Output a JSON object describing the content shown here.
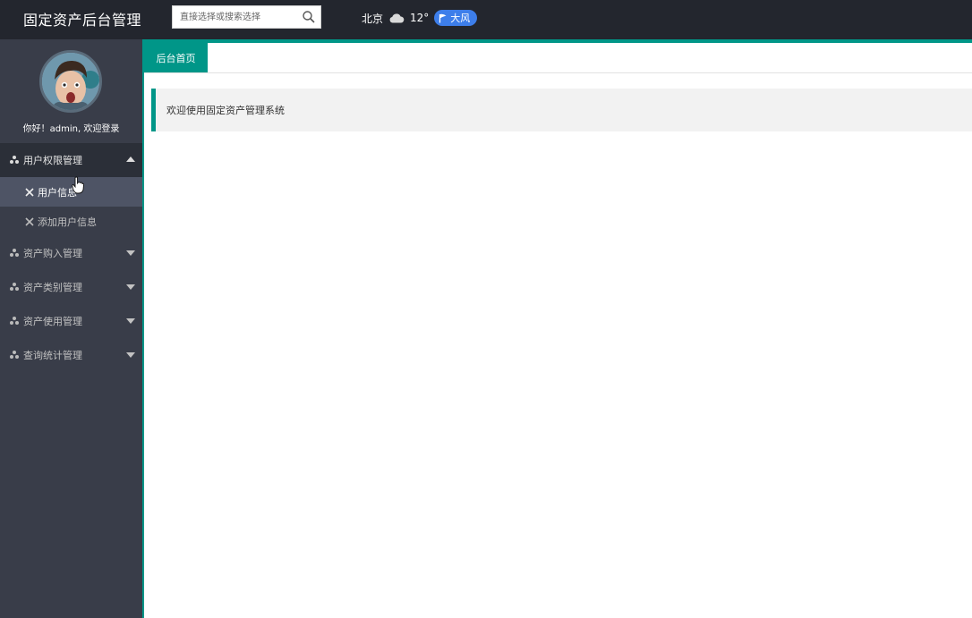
{
  "header": {
    "title": "固定资产后台管理",
    "search": {
      "placeholder": "直接选择或搜索选择",
      "value": ""
    },
    "weather": {
      "city": "北京",
      "temperature": "12°",
      "condition_icon": "cloud-icon",
      "wind": "大风",
      "wind_icon": "flag-icon"
    }
  },
  "sidebar": {
    "avatar_icon": "avatar",
    "greeting": "你好！admin, 欢迎登录",
    "groups": [
      {
        "label": "用户权限管理",
        "expanded": true,
        "items": [
          {
            "label": "用户信息",
            "active": true
          },
          {
            "label": "添加用户信息",
            "active": false
          }
        ]
      },
      {
        "label": "资产购入管理",
        "expanded": false
      },
      {
        "label": "资产类别管理",
        "expanded": false
      },
      {
        "label": "资产使用管理",
        "expanded": false
      },
      {
        "label": "查询统计管理",
        "expanded": false
      }
    ]
  },
  "tabs": [
    {
      "label": "后台首页",
      "active": true
    }
  ],
  "main": {
    "welcome": "欢迎使用固定资产管理系统"
  },
  "colors": {
    "header_bg": "#23262e",
    "sidebar_bg": "#393d49",
    "accent": "#009688",
    "badge": "#3d7eea"
  }
}
